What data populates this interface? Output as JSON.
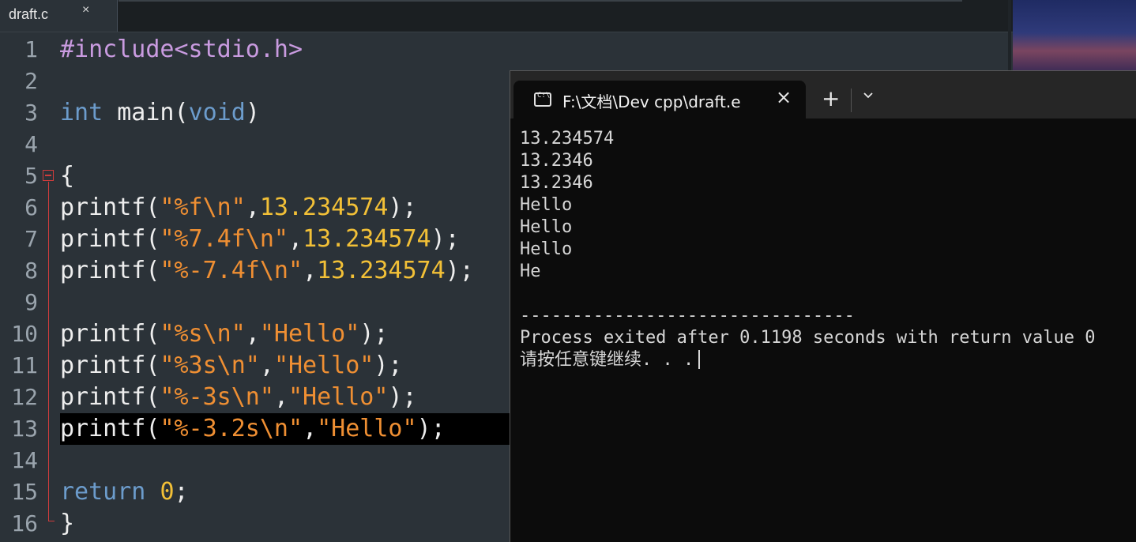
{
  "editor": {
    "tab_title": "draft.c",
    "tab_close": "×",
    "line_numbers": [
      "1",
      "2",
      "3",
      "4",
      "5",
      "6",
      "7",
      "8",
      "9",
      "10",
      "11",
      "12",
      "13",
      "14",
      "15",
      "16"
    ],
    "lines": [
      {
        "segments": [
          {
            "t": "#include<stdio.h>",
            "c": "pre"
          }
        ]
      },
      {
        "segments": []
      },
      {
        "segments": [
          {
            "t": "int",
            "c": "kw"
          },
          {
            "t": " main(",
            "c": "pn"
          },
          {
            "t": "void",
            "c": "kw"
          },
          {
            "t": ")",
            "c": "pn"
          }
        ]
      },
      {
        "segments": []
      },
      {
        "segments": [
          {
            "t": "{",
            "c": "pn"
          }
        ]
      },
      {
        "segments": [
          {
            "t": "printf(",
            "c": "pn"
          },
          {
            "t": "\"%f\\n\"",
            "c": "str"
          },
          {
            "t": ",",
            "c": "pn"
          },
          {
            "t": "13.234574",
            "c": "num"
          },
          {
            "t": ");",
            "c": "pn"
          }
        ]
      },
      {
        "segments": [
          {
            "t": "printf(",
            "c": "pn"
          },
          {
            "t": "\"%7.4f\\n\"",
            "c": "str"
          },
          {
            "t": ",",
            "c": "pn"
          },
          {
            "t": "13.234574",
            "c": "num"
          },
          {
            "t": ");",
            "c": "pn"
          }
        ]
      },
      {
        "segments": [
          {
            "t": "printf(",
            "c": "pn"
          },
          {
            "t": "\"%-7.4f\\n\"",
            "c": "str"
          },
          {
            "t": ",",
            "c": "pn"
          },
          {
            "t": "13.234574",
            "c": "num"
          },
          {
            "t": ");",
            "c": "pn"
          }
        ]
      },
      {
        "segments": []
      },
      {
        "segments": [
          {
            "t": "printf(",
            "c": "pn"
          },
          {
            "t": "\"%s\\n\"",
            "c": "str"
          },
          {
            "t": ",",
            "c": "pn"
          },
          {
            "t": "\"Hello\"",
            "c": "str"
          },
          {
            "t": ");",
            "c": "pn"
          }
        ]
      },
      {
        "segments": [
          {
            "t": "printf(",
            "c": "pn"
          },
          {
            "t": "\"%3s\\n\"",
            "c": "str"
          },
          {
            "t": ",",
            "c": "pn"
          },
          {
            "t": "\"Hello\"",
            "c": "str"
          },
          {
            "t": ");",
            "c": "pn"
          }
        ]
      },
      {
        "segments": [
          {
            "t": "printf(",
            "c": "pn"
          },
          {
            "t": "\"%-3s\\n\"",
            "c": "str"
          },
          {
            "t": ",",
            "c": "pn"
          },
          {
            "t": "\"Hello\"",
            "c": "str"
          },
          {
            "t": ");",
            "c": "pn"
          }
        ]
      },
      {
        "segments": [
          {
            "t": "printf(",
            "c": "pn"
          },
          {
            "t": "\"%-3.2s\\n\"",
            "c": "str"
          },
          {
            "t": ",",
            "c": "pn"
          },
          {
            "t": "\"Hello\"",
            "c": "str"
          },
          {
            "t": ");",
            "c": "pn"
          }
        ],
        "current": true
      },
      {
        "segments": []
      },
      {
        "segments": [
          {
            "t": "return",
            "c": "kw"
          },
          {
            "t": " ",
            "c": "pn"
          },
          {
            "t": "0",
            "c": "num"
          },
          {
            "t": ";",
            "c": "pn"
          }
        ]
      },
      {
        "segments": [
          {
            "t": "}",
            "c": "pn"
          }
        ]
      }
    ]
  },
  "terminal": {
    "tab_title": "F:\\文档\\Dev cpp\\draft.e",
    "tab_icon_text": "C:\\",
    "tab_close": "×",
    "new_tab": "+",
    "output_lines": [
      "13.234574",
      "13.2346",
      "13.2346",
      "Hello",
      "Hello",
      "Hello",
      "He",
      "",
      "--------------------------------",
      "Process exited after 0.1198 seconds with return value 0",
      "请按任意键继续. . ."
    ]
  },
  "colors": {
    "editor_bg": "#2b3238",
    "preprocessor": "#c99be0",
    "keyword": "#6c9ccc",
    "string": "#ef8f33",
    "number": "#f2c037",
    "terminal_bg": "#0c0c0c"
  }
}
